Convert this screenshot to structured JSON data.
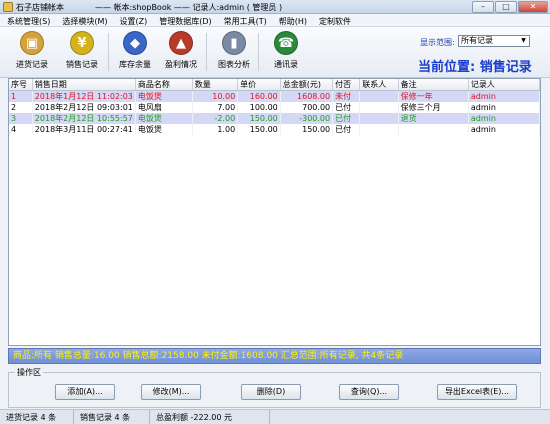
{
  "window": {
    "app_title": "石子店铺帐本",
    "title_detail": "—— 帐本:shopBook —— 记录人:admin ( 管理员 )",
    "min_glyph": "–",
    "max_glyph": "□",
    "close_glyph": "✕"
  },
  "menu": [
    "系统管理(S)",
    "选择模块(M)",
    "设置(Z)",
    "管理数据库(D)",
    "常用工具(T)",
    "帮助(H)",
    "定制软件"
  ],
  "toolbar": {
    "tools": [
      {
        "label": "进货记录",
        "icon": "purchase-box-icon",
        "glyph": "▣",
        "color": "#d6a23a"
      },
      {
        "label": "销售记录",
        "icon": "sales-money-icon",
        "glyph": "¥",
        "color": "#d4b21c"
      },
      {
        "label": "库存余量",
        "icon": "inventory-icon",
        "glyph": "◆",
        "color": "#3a66c8"
      },
      {
        "label": "盈利情况",
        "icon": "profit-icon",
        "glyph": "▲",
        "color": "#b83a2a"
      },
      {
        "label": "图表分析",
        "icon": "chart-icon",
        "glyph": "▮",
        "color": "#7a8aa4"
      },
      {
        "label": "通讯录",
        "icon": "phone-icon",
        "glyph": "☎",
        "color": "#2a8a3a"
      }
    ],
    "scope_label": "显示范围:",
    "scope_value": "所有记录",
    "scope_arrow": "▼",
    "location": "当前位置: 销售记录"
  },
  "table": {
    "columns": [
      "序号",
      "销售日期",
      "商品名称",
      "数量",
      "单价",
      "总金额(元)",
      "付否",
      "联系人",
      "备注",
      "记录人"
    ],
    "rows": [
      {
        "style": "red shade",
        "cells": [
          "1",
          "2018年1月12日 11:02:03",
          "电饭煲",
          "10.00",
          "160.00",
          "1608.00",
          "未付",
          "",
          "保修一年",
          "admin"
        ]
      },
      {
        "style": "",
        "cells": [
          "2",
          "2018年2月12日 09:03:01",
          "电风扇",
          "7.00",
          "100.00",
          "700.00",
          "已付",
          "",
          "保修三个月",
          "admin"
        ]
      },
      {
        "style": "green shade",
        "cells": [
          "3",
          "2018年2月12日 10:55:57",
          "电饭煲",
          "-2.00",
          "150.00",
          "-300.00",
          "已付",
          "",
          "退货",
          "admin"
        ]
      },
      {
        "style": "",
        "cells": [
          "4",
          "2018年3月11日 00:27:41",
          "电饭煲",
          "1.00",
          "150.00",
          "150.00",
          "已付",
          "",
          "",
          "admin"
        ]
      }
    ]
  },
  "summary": "商品:所有  销售总量:16.00  销售总额:2158.00  未付金额:1608.00  汇总范围:所有记录, 共4条记录",
  "ops": {
    "title": "操作区",
    "buttons": [
      "添加(A)...",
      "修改(M)...",
      "删除(D)",
      "查询(Q)...",
      "导出Excel表(E)..."
    ]
  },
  "status": [
    "进货记录 4 条",
    "销售记录 4 条",
    "总盈利额 -222.00 元"
  ],
  "colors": {
    "location": "#1a3ccc",
    "summary_text": "#fff200",
    "unpaid_row": "#e0141e",
    "return_row": "#1f9b1f"
  }
}
